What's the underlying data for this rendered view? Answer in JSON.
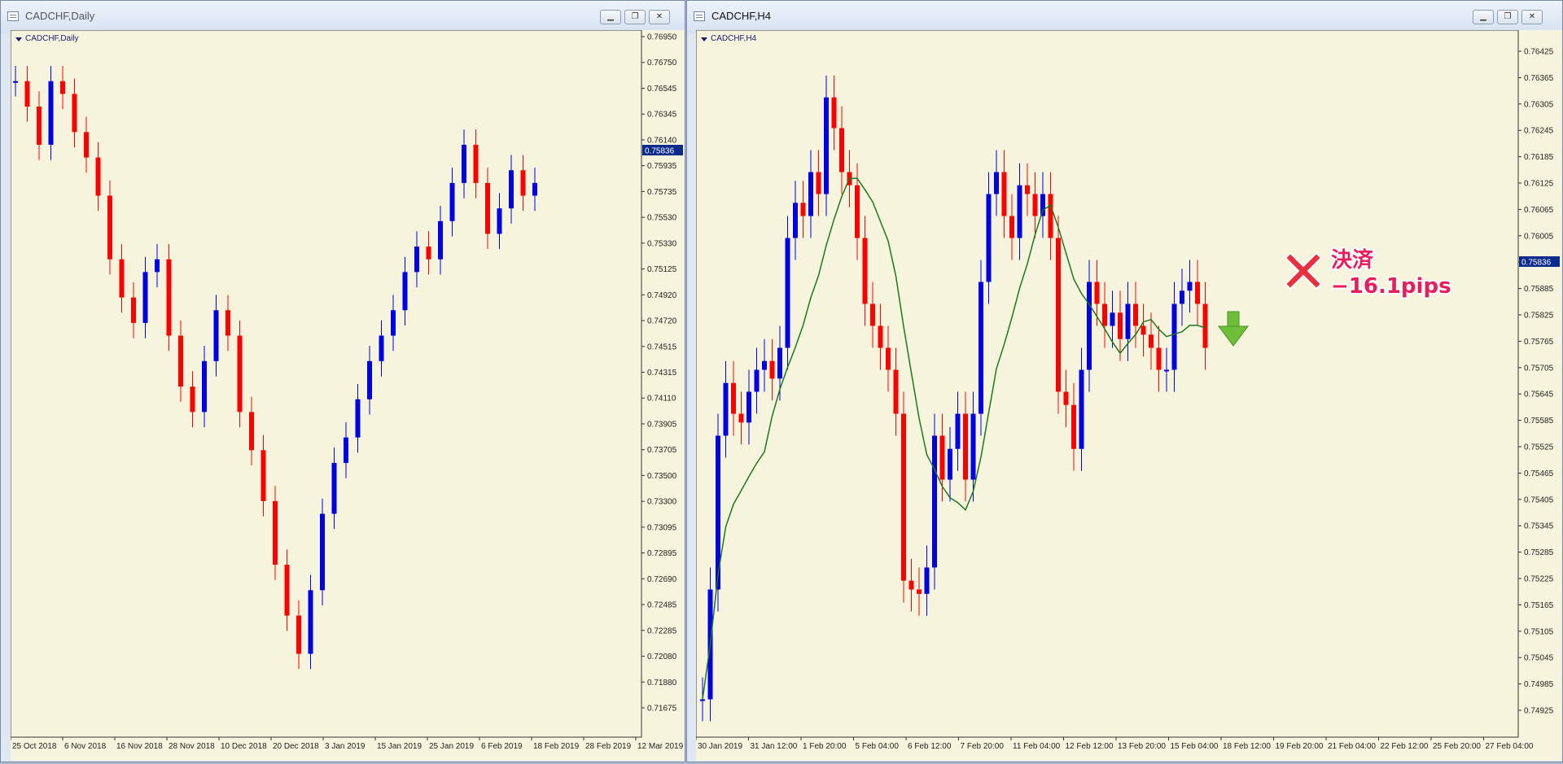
{
  "windows": [
    {
      "title": "CADCHF,Daily",
      "symbol_label": "CADCHF,Daily",
      "price_labels": [
        "0.76950",
        "0.76750",
        "0.76545",
        "0.76345",
        "0.76140",
        "0.75935",
        "0.75735",
        "0.75530",
        "0.75330",
        "0.75125",
        "0.74920",
        "0.74720",
        "0.74515",
        "0.74315",
        "0.74110",
        "0.73905",
        "0.73705",
        "0.73500",
        "0.73300",
        "0.73095",
        "0.72895",
        "0.72690",
        "0.72485",
        "0.72285",
        "0.72080",
        "0.71880",
        "0.71675"
      ],
      "current_price": "0.75836",
      "time_labels": [
        "25 Oct 2018",
        "6 Nov 2018",
        "16 Nov 2018",
        "28 Nov 2018",
        "10 Dec 2018",
        "20 Dec 2018",
        "3 Jan 2019",
        "15 Jan 2019",
        "25 Jan 2019",
        "6 Feb 2019",
        "18 Feb 2019",
        "28 Feb 2019",
        "12 Mar 2019"
      ]
    },
    {
      "title": "CADCHF,H4",
      "symbol_label": "CADCHF,H4",
      "price_labels": [
        "0.76425",
        "0.76365",
        "0.76305",
        "0.76245",
        "0.76185",
        "0.76125",
        "0.76065",
        "0.76005",
        "0.75945",
        "0.75885",
        "0.75825",
        "0.75765",
        "0.75705",
        "0.75645",
        "0.75585",
        "0.75525",
        "0.75465",
        "0.75405",
        "0.75345",
        "0.75285",
        "0.75225",
        "0.75165",
        "0.75105",
        "0.75045",
        "0.74985",
        "0.74925"
      ],
      "current_price": "0.75836",
      "time_labels": [
        "30 Jan 2019",
        "31 Jan 12:00",
        "1 Feb 20:00",
        "5 Feb 04:00",
        "6 Feb 12:00",
        "7 Feb 20:00",
        "11 Feb 04:00",
        "12 Feb 12:00",
        "13 Feb 20:00",
        "15 Feb 04:00",
        "18 Feb 12:00",
        "19 Feb 20:00",
        "21 Feb 04:00",
        "22 Feb 12:00",
        "25 Feb 20:00",
        "27 Feb 04:00"
      ],
      "annotation": {
        "line1": "決済",
        "line2": "−16.1pips"
      }
    }
  ],
  "colors": {
    "bull": "#0000e6",
    "bear": "#ff0000",
    "ma": "#1a7a1a",
    "chart_bg": "#f6f4dc",
    "price_tag": "#0b2c8c"
  }
}
